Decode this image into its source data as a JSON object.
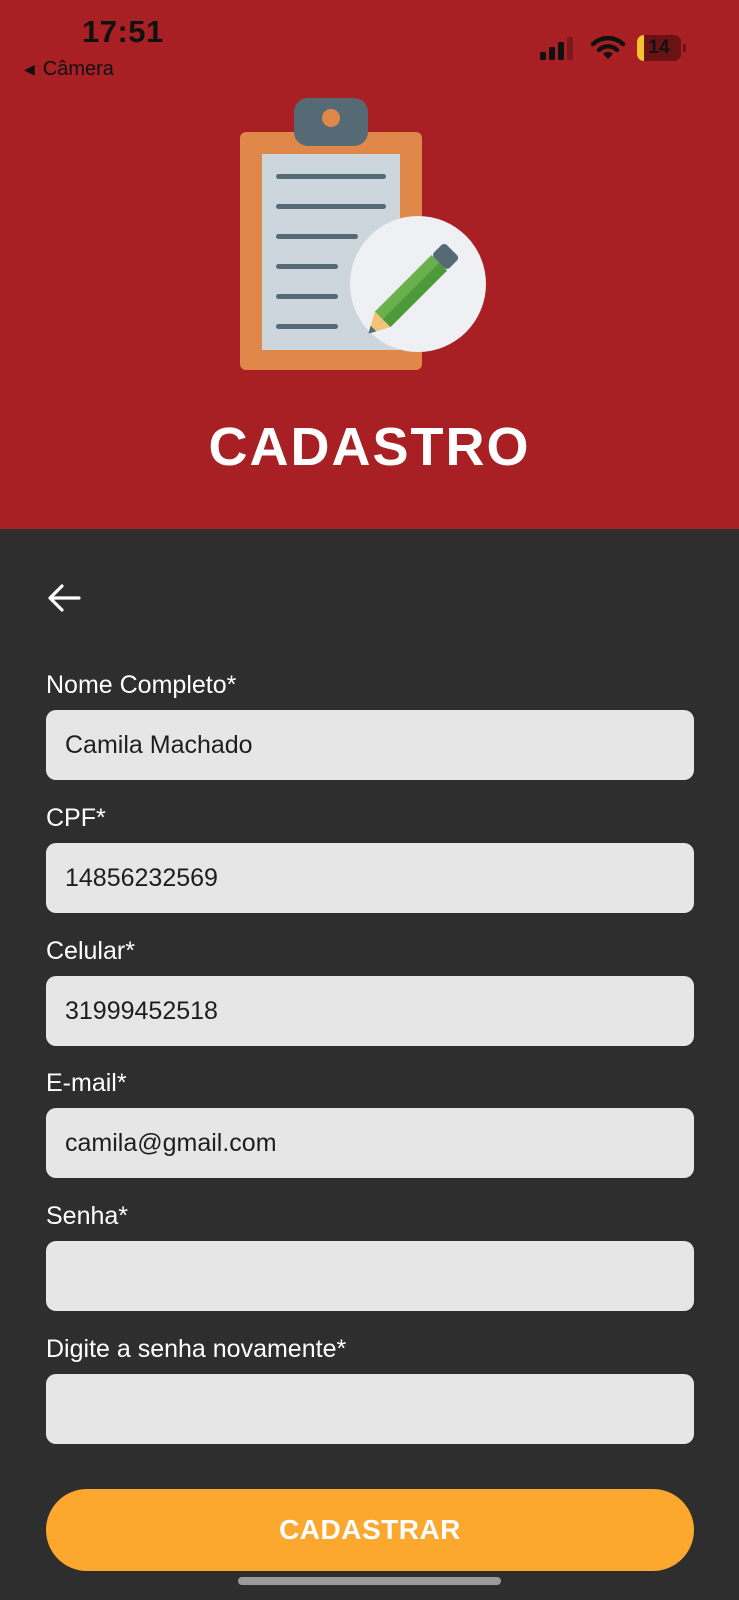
{
  "status_bar": {
    "time": "17:51",
    "back_label": "Câmera",
    "battery_level": "14"
  },
  "header": {
    "title": "CADASTRO",
    "background_color": "#a82023"
  },
  "form": {
    "fields": [
      {
        "label": "Nome Completo*",
        "value": "Camila Machado"
      },
      {
        "label": "CPF*",
        "value": "14856232569"
      },
      {
        "label": "Celular*",
        "value": "31999452518"
      },
      {
        "label": "E-mail*",
        "value": "camila@gmail.com"
      },
      {
        "label": "Senha*",
        "value": ""
      },
      {
        "label": "Digite a senha novamente*",
        "value": ""
      }
    ],
    "submit_label": "CADASTRAR"
  },
  "icons": {
    "back": "arrow-left-icon",
    "logo": "clipboard-pencil-icon"
  },
  "colors": {
    "accent": "#fca72d",
    "background": "#2e2e2e",
    "input_background": "#e6e6e6"
  }
}
